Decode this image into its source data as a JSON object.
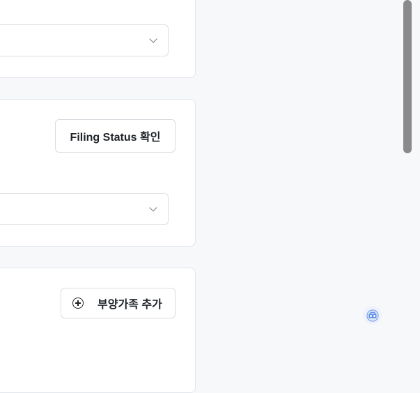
{
  "filing_section": {
    "filing_status_button_label": "Filing Status 확인"
  },
  "dependents_section": {
    "add_dependent_button_label": "부양가족 추가"
  },
  "icons": {
    "select_chevron": "chevron-down-icon",
    "add": "plus-circle-icon",
    "widget": "translate-icon"
  },
  "colors": {
    "page_background": "#f7f8fa",
    "card_border": "#e2e5ea",
    "scrollbar_thumb": "#8a8a8a",
    "widget_accent": "#5b8de8"
  }
}
